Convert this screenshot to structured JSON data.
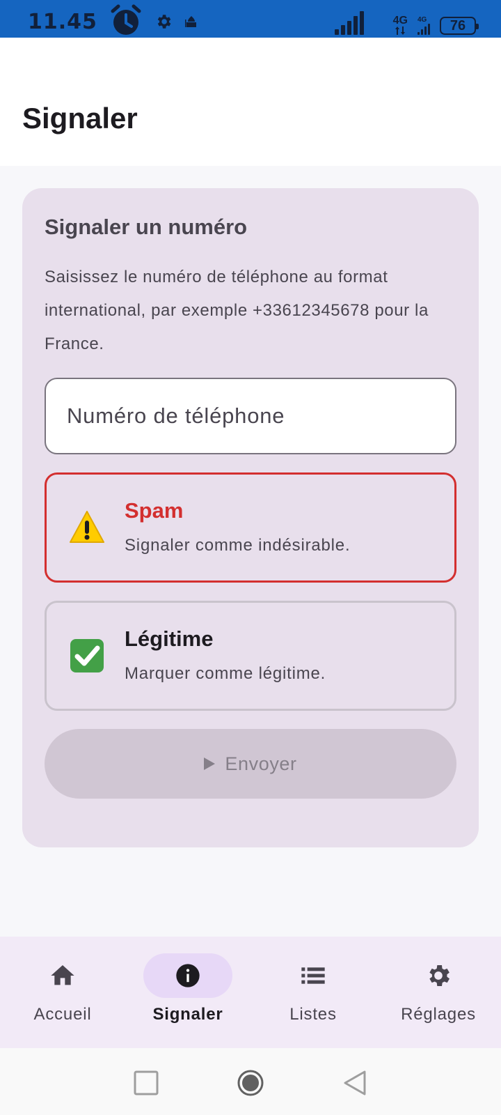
{
  "status_bar": {
    "time": "11.45",
    "network_primary": "4G",
    "network_secondary": "4G",
    "battery": "76",
    "background_color": "#1565c0"
  },
  "app_bar": {
    "title": "Signaler"
  },
  "report_card": {
    "title": "Signaler un numéro",
    "description": "Saisissez le numéro de téléphone au format international, par exemple +33612345678 pour la France.",
    "phone_input": {
      "value": "",
      "placeholder": "Numéro de téléphone"
    },
    "options": {
      "spam": {
        "icon": "warning-icon",
        "label": "Spam",
        "sublabel": "Signaler comme indésirable.",
        "selected": true,
        "accent_color": "#d32f2f"
      },
      "legit": {
        "icon": "check-mark-icon",
        "label": "Légitime",
        "sublabel": "Marquer comme légitime.",
        "selected": false
      }
    },
    "send_button": {
      "icon": "play-icon",
      "label": "Envoyer",
      "disabled": true
    }
  },
  "bottom_nav": {
    "items": [
      {
        "label": "Accueil",
        "icon": "home-icon",
        "active": false
      },
      {
        "label": "Signaler",
        "icon": "info-icon",
        "active": true
      },
      {
        "label": "Listes",
        "icon": "list-icon",
        "active": false
      },
      {
        "label": "Réglages",
        "icon": "gear-icon",
        "active": false
      }
    ]
  },
  "system_nav": {
    "buttons": [
      "recents-icon",
      "home-circle-icon",
      "back-icon"
    ]
  }
}
